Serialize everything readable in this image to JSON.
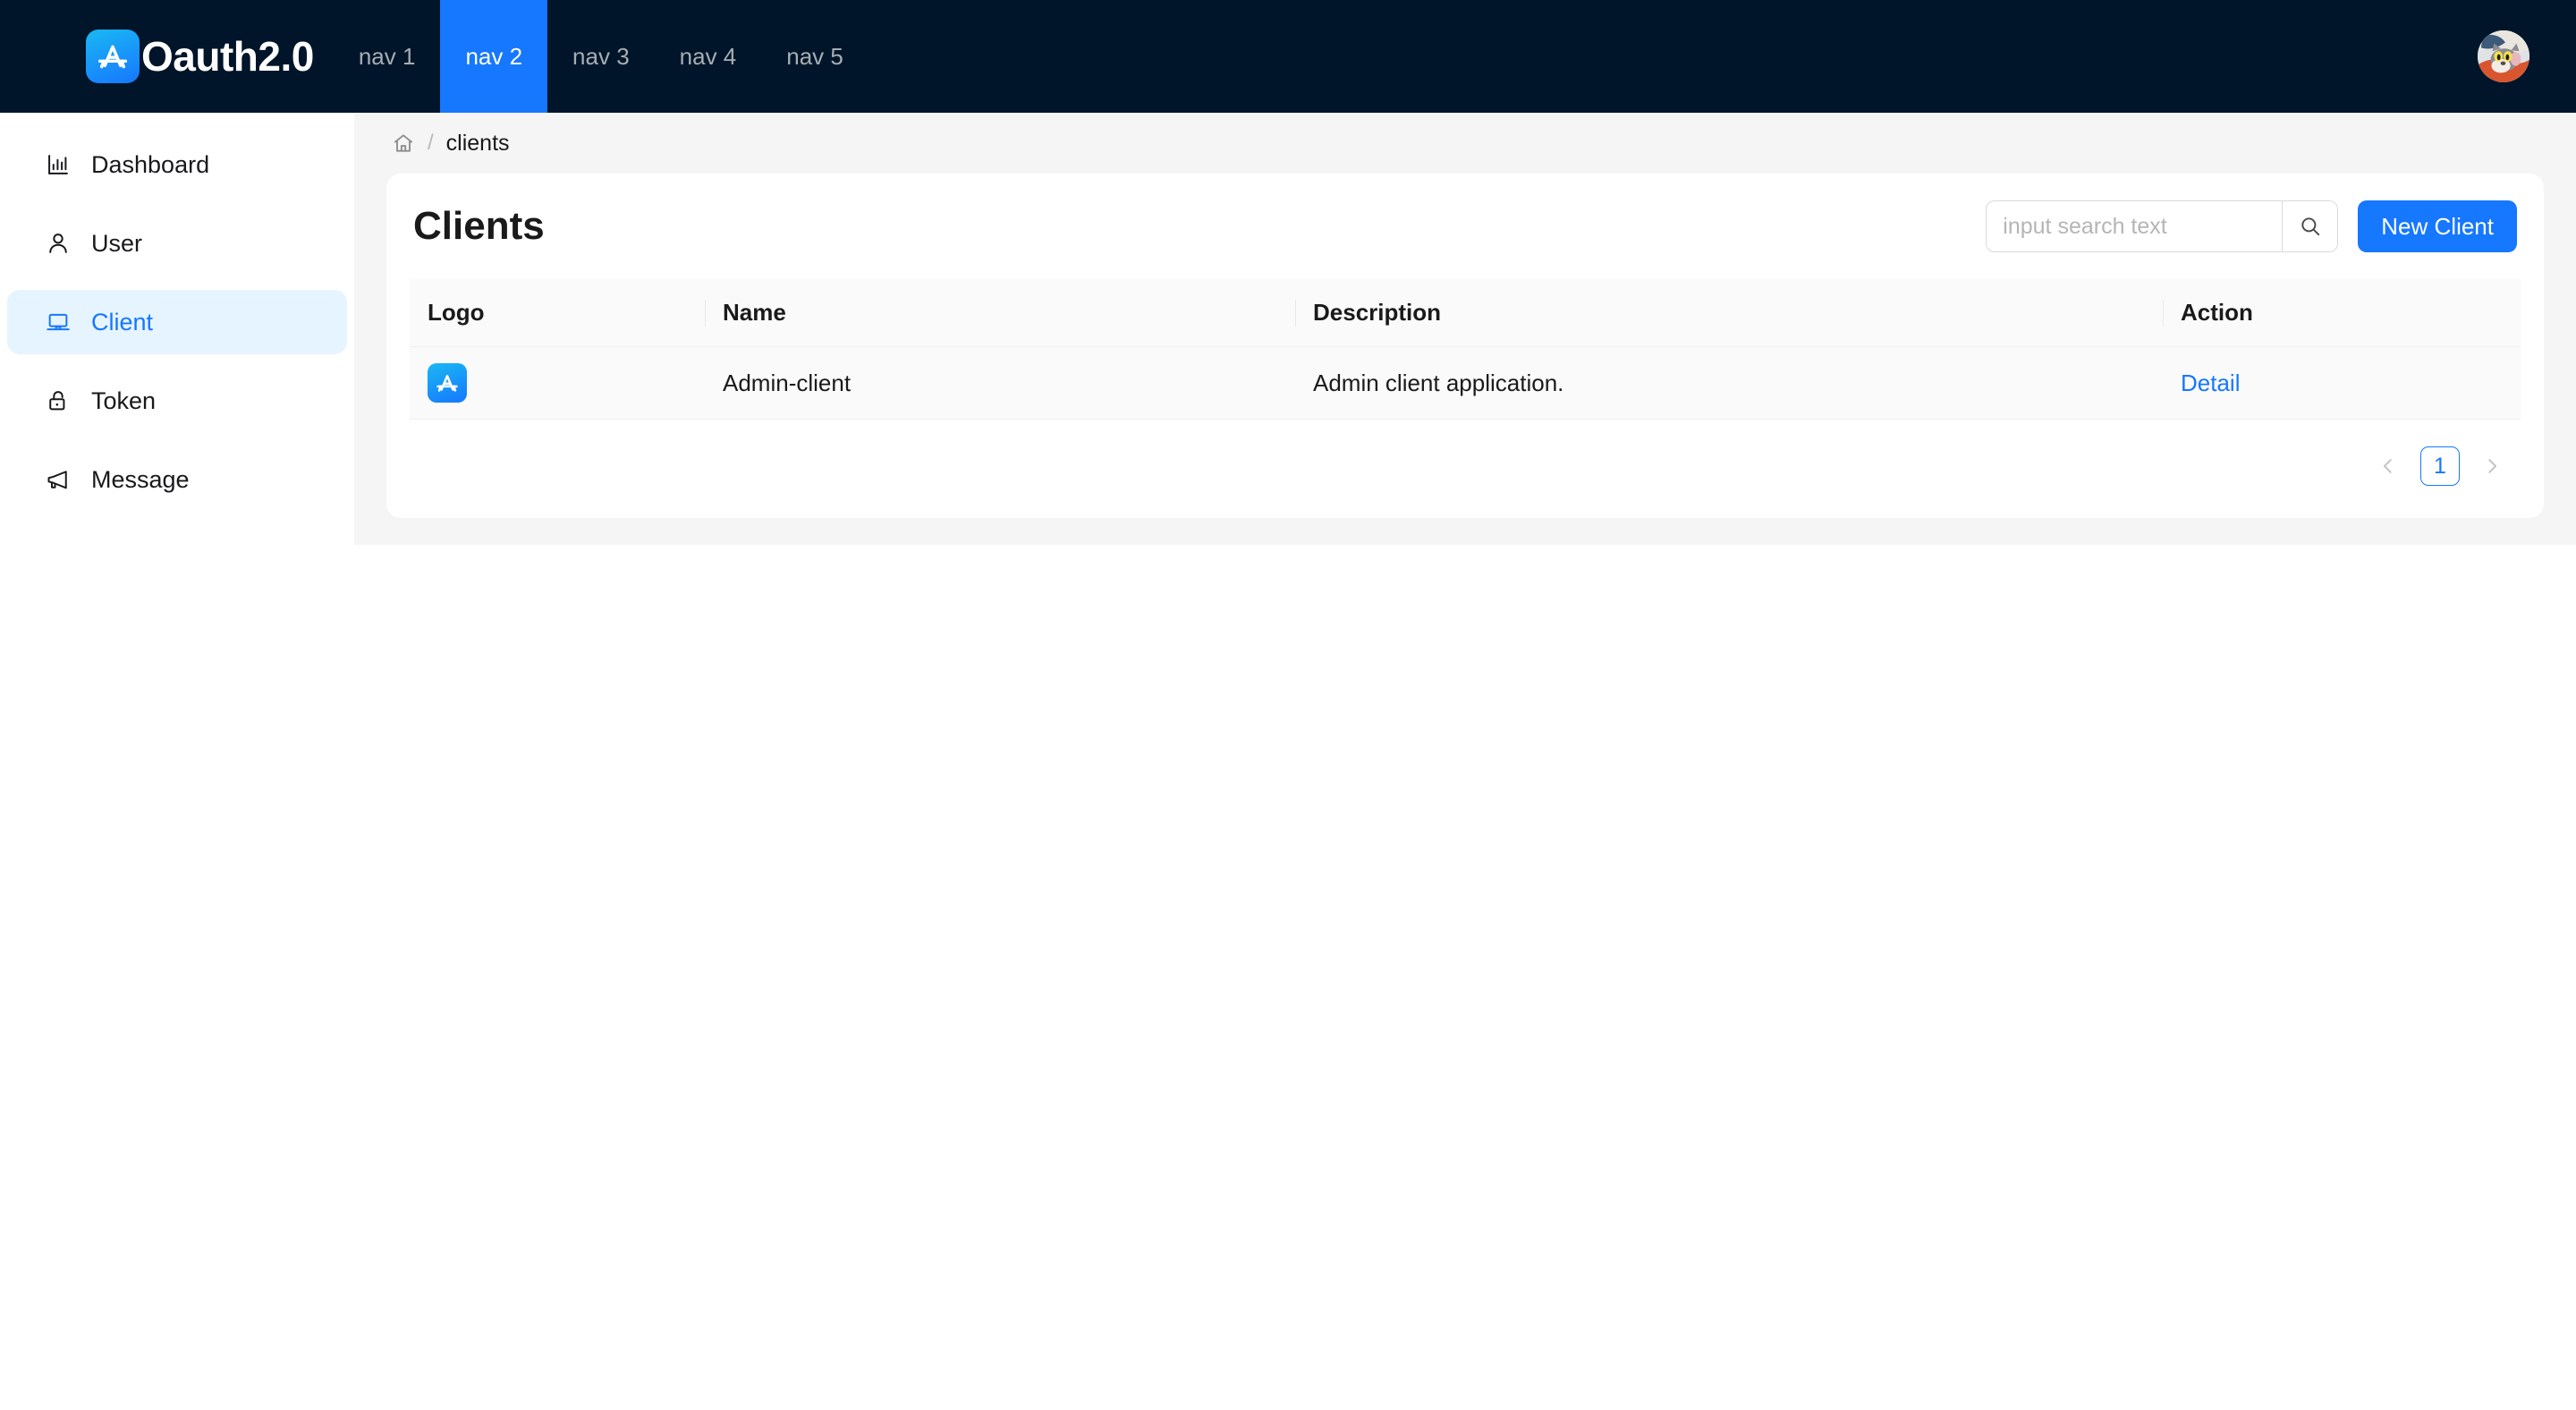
{
  "header": {
    "brand_name": "Oauth2.0",
    "brand_logo_icon": "appstore-icon",
    "nav": [
      {
        "label": "nav 1",
        "active": false
      },
      {
        "label": "nav 2",
        "active": true
      },
      {
        "label": "nav 3",
        "active": false
      },
      {
        "label": "nav 4",
        "active": false
      },
      {
        "label": "nav 5",
        "active": false
      }
    ],
    "avatar_icon": "user-avatar",
    "bg_color": "#001529",
    "active_nav_color": "#1677ff"
  },
  "sidebar": {
    "items": [
      {
        "label": "Dashboard",
        "icon": "bar-chart-icon",
        "active": false
      },
      {
        "label": "User",
        "icon": "user-icon",
        "active": false
      },
      {
        "label": "Client",
        "icon": "laptop-icon",
        "active": true
      },
      {
        "label": "Token",
        "icon": "unlock-icon",
        "active": false
      },
      {
        "label": "Message",
        "icon": "notification-icon",
        "active": false
      }
    ],
    "active_bg": "#e6f4ff",
    "active_color": "#1677ff"
  },
  "breadcrumb": {
    "home_icon": "home-icon",
    "separator": "/",
    "current": "clients"
  },
  "main": {
    "title": "Clients",
    "search": {
      "value": "",
      "placeholder": "input search text",
      "icon": "search-icon"
    },
    "new_button_label": "New Client",
    "primary_color": "#1677ff",
    "table": {
      "columns": [
        "Logo",
        "Name",
        "Description",
        "Action"
      ],
      "rows": [
        {
          "logo_icon": "appstore-icon",
          "name": "Admin-client",
          "description": "Admin client application.",
          "action_label": "Detail"
        }
      ]
    },
    "pagination": {
      "prev_icon": "chevron-left-icon",
      "next_icon": "chevron-right-icon",
      "pages": [
        "1"
      ],
      "current": "1"
    }
  }
}
